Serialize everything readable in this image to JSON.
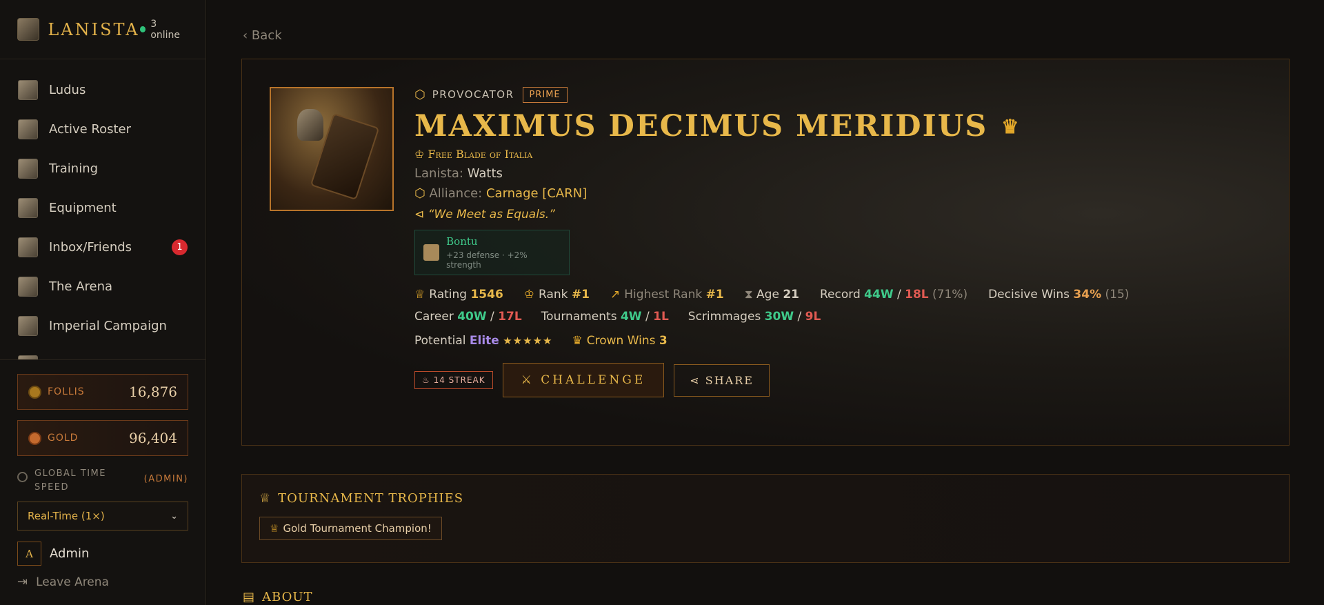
{
  "brand": {
    "name": "LANISTA",
    "online": "3 online"
  },
  "nav": [
    {
      "label": "Ludus"
    },
    {
      "label": "Active Roster"
    },
    {
      "label": "Training"
    },
    {
      "label": "Equipment"
    },
    {
      "label": "Inbox/Friends",
      "badge": "1"
    },
    {
      "label": "The Arena"
    },
    {
      "label": "Imperial Campaign"
    }
  ],
  "currency": {
    "follis_label": "FOLLIS",
    "follis_value": "16,876",
    "gold_label": "GOLD",
    "gold_value": "96,404"
  },
  "speed": {
    "label": "GLOBAL TIME SPEED",
    "admin": "(ADMIN)",
    "selected": "Real-Time (1×)"
  },
  "user": {
    "initial": "A",
    "name": "Admin",
    "leave": "Leave Arena"
  },
  "back": "Back",
  "gladiator": {
    "class": "PROVOCATOR",
    "prime": "PRIME",
    "name": "MAXIMUS DECIMUS MERIDIUS",
    "subtitle": "Free Blade of Italia",
    "lanista_label": "Lanista:",
    "lanista": "Watts",
    "alliance_label": "Alliance:",
    "alliance": "Carnage [CARN]",
    "motto": "“We Meet as Equals.”",
    "buff_name": "Bontu",
    "buff_desc": "+23 defense · +2% strength"
  },
  "stats": {
    "rating_label": "Rating",
    "rating": "1546",
    "rank_label": "Rank",
    "rank": "#1",
    "highest_label": "Highest Rank",
    "highest": "#1",
    "age_label": "Age",
    "age": "21",
    "record_label": "Record",
    "record_w": "44W",
    "record_l": "18L",
    "record_pct": "(71%)",
    "decisive_label": "Decisive Wins",
    "decisive_pct": "34%",
    "decisive_n": "(15)",
    "career_label": "Career",
    "career_w": "40W",
    "career_l": "17L",
    "tourn_label": "Tournaments",
    "tourn_w": "4W",
    "tourn_l": "1L",
    "scrim_label": "Scrimmages",
    "scrim_w": "30W",
    "scrim_l": "9L",
    "potential_label": "Potential",
    "potential": "Elite",
    "stars": "★★★★★",
    "crown_label": "Crown Wins",
    "crown": "3"
  },
  "actions": {
    "streak": "14 STREAK",
    "challenge": "CHALLENGE",
    "share": "SHARE"
  },
  "trophies": {
    "title": "TOURNAMENT TROPHIES",
    "items": [
      "Gold Tournament Champion!"
    ]
  },
  "about": {
    "title": "ABOUT"
  }
}
